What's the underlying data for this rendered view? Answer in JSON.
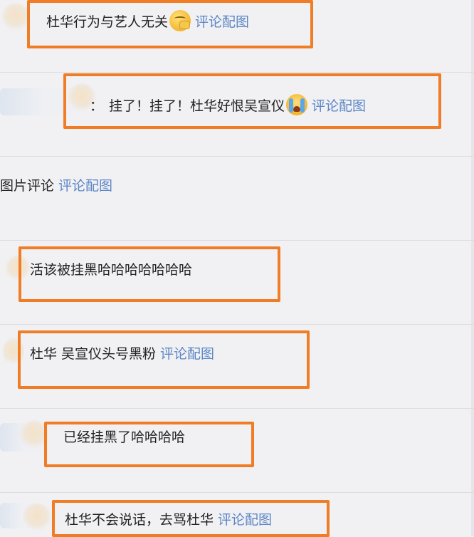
{
  "comments": [
    {
      "text": "杜华行为与艺人无关",
      "emoji": "grinning-face-icon",
      "link": "评论配图"
    },
    {
      "prefix": "：",
      "text": "挂了！挂了！杜华好恨吴宣仪",
      "emoji": "crying-face-icon",
      "link": "评论配图"
    },
    {
      "text": "图片评论",
      "link": "评论配图"
    },
    {
      "text": "活该被挂黑哈哈哈哈哈哈哈"
    },
    {
      "text": "杜华 吴宣仪头号黑粉",
      "link": "评论配图"
    },
    {
      "text": "已经挂黑了哈哈哈哈"
    },
    {
      "text": "杜华不会说话，去骂杜华",
      "link": "评论配图"
    }
  ],
  "colors": {
    "highlight_border": "#f07d25",
    "link": "#5b86c5",
    "background": "#f1f1f4"
  }
}
